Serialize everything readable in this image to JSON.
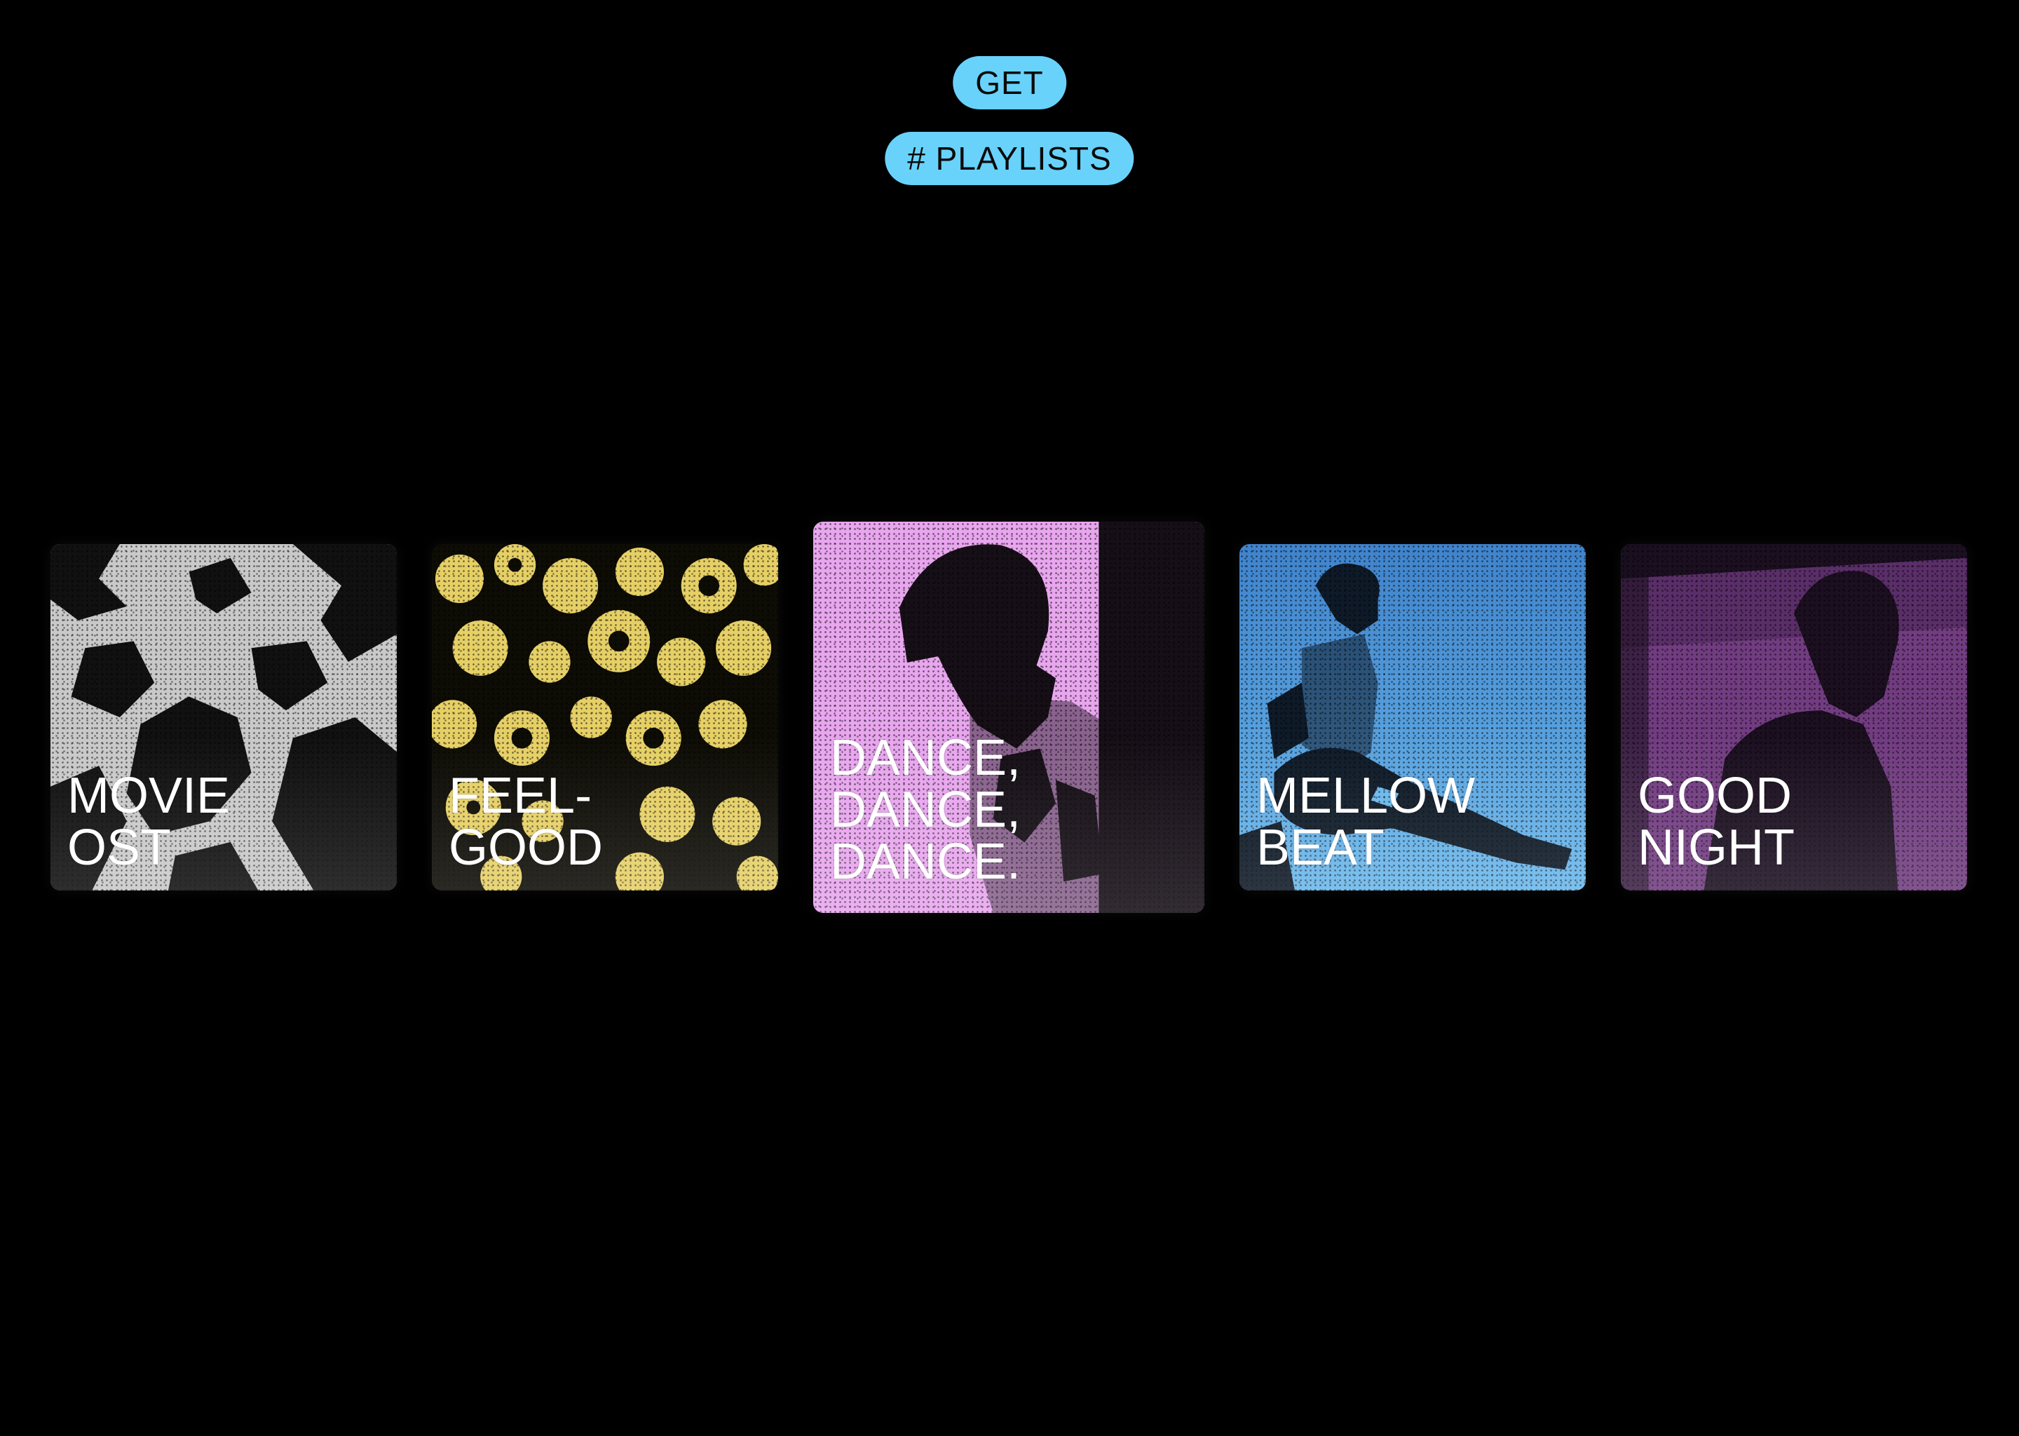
{
  "header": {
    "get_label": "GET",
    "playlists_label": "# PLAYLISTS"
  },
  "playlists": [
    {
      "title": "MOVIE\nOST",
      "color": "#c9c9c9"
    },
    {
      "title": "FEEL-\nGOOD",
      "color": "#e6d066"
    },
    {
      "title": "DANCE,\nDANCE,\nDANCE.",
      "color": "#e8a6ee"
    },
    {
      "title": "MELLOW\nBEAT",
      "color": "#4b8fd6"
    },
    {
      "title": "GOOD NIGHT",
      "color": "#8a4a9a"
    }
  ],
  "colors": {
    "background": "#000000",
    "accent": "#69d2fb"
  }
}
